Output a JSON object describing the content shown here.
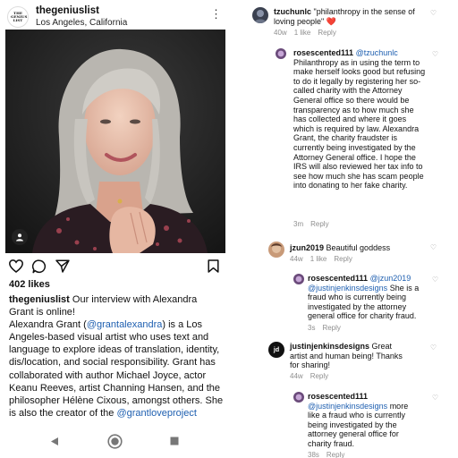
{
  "post": {
    "account": "thegeniuslist",
    "location": "Los Angeles, California",
    "logo_text": "THE GENIUS LIST",
    "likes": "402 likes",
    "caption": {
      "user": "thegeniuslist",
      "line1": " Our interview with Alexandra Grant is online!",
      "p2a": "Alexandra Grant (",
      "mention1": "@grantalexandra",
      "p2b": ") is a Los Angeles-based visual artist who uses text and language to explore ideas of translation, identity, dis/location, and social responsibility. Grant has collaborated with author Michael Joyce, actor Keanu Reeves, artist Channing Hansen, and the philosopher Hélène Cixous, amongst others. She is also the creator of the ",
      "mention2": "@grantloveproject"
    }
  },
  "comments": [
    {
      "user": "tzuchunlc",
      "text": " \"philanthropy in the sense of loving people\" ",
      "emoji": "❤️",
      "time": "40w",
      "likes": "1 like",
      "reply": "Reply"
    },
    {
      "user": "rosescented111",
      "mention": "@tzuchunlc",
      "text": " Philanthropy as in using the term to make herself looks good but refusing to do it legally by registering her so-called charity with the Attorney General office so there would be transparency as to how much she has collected and where it goes which is required by law. Alexandra Grant, the charity fraudster is currently being investigated by the Attorney General office. I hope the IRS will also reviewed her tax info to see how much she has scam people into donating to her fake charity.",
      "time": "3m",
      "reply": "Reply"
    },
    {
      "user": "jzun2019",
      "text": " Beautiful goddess",
      "time": "44w",
      "likes": "1 like",
      "reply": "Reply"
    },
    {
      "user": "rosescented111",
      "mention": "@jzun2019",
      "mention2": "@justinjenkinsdesigns",
      "text": " She is a fraud who is currently being investigated by the attorney general office for charity fraud.",
      "time": "3s",
      "reply": "Reply"
    },
    {
      "user": "justinjenkinsdesigns",
      "text": " Great artist and human being! Thanks for sharing!",
      "time": "44w",
      "reply": "Reply",
      "avatar_text": "jd"
    },
    {
      "user": "rosescented111",
      "mention": "@justinjenkinsdesigns",
      "text": " more like a fraud who is currently being investigated by the attorney general office for charity fraud.",
      "time": "38s",
      "reply": "Reply"
    }
  ],
  "colors": {
    "mention": "#1e5fb0",
    "meta": "#8e8e8e",
    "heart": "#e0245e"
  },
  "icons": [
    "heart-icon",
    "comment-icon",
    "share-icon",
    "bookmark-icon",
    "more-icon",
    "user-tag-icon",
    "back-icon",
    "home-icon",
    "recent-apps-icon"
  ]
}
